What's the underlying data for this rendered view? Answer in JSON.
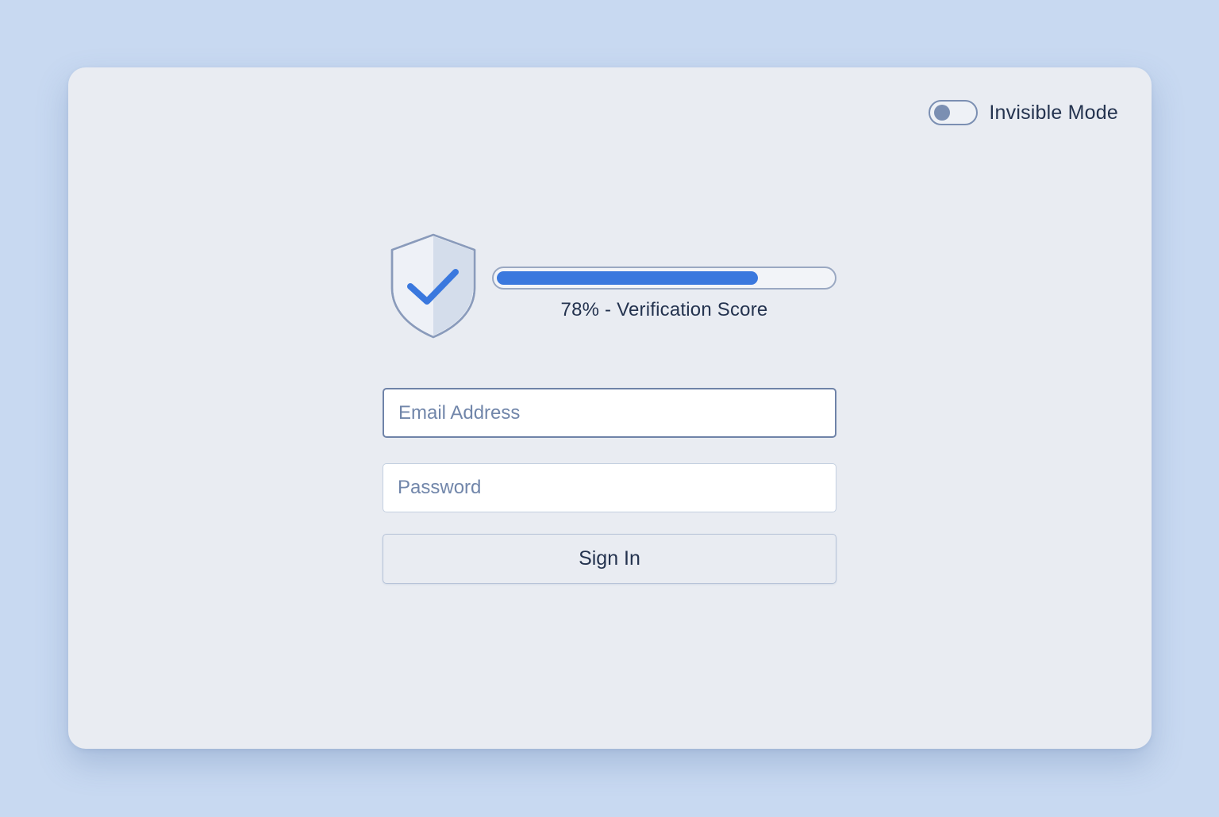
{
  "toggle": {
    "label": "Invisible Mode",
    "on": false
  },
  "verification": {
    "score_percent": 78,
    "score_text": "78% - Verification Score",
    "icon": "shield-check-icon"
  },
  "form": {
    "email_placeholder": "Email Address",
    "email_value": "",
    "password_placeholder": "Password",
    "password_value": "",
    "submit_label": "Sign In"
  },
  "colors": {
    "background": "#c8d9f1",
    "card": "#e9ecf2",
    "accent": "#3a78de",
    "text": "#24334f",
    "muted": "#7b8fb2"
  }
}
